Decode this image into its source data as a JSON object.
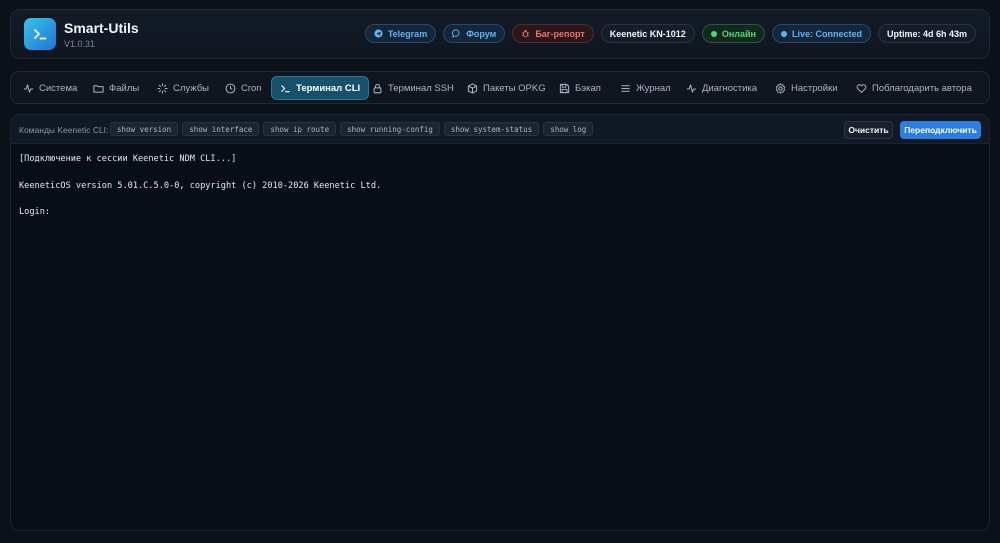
{
  "app": {
    "title": "Smart-Utils",
    "version": "V1.0.31"
  },
  "header_badges": {
    "telegram": "Telegram",
    "forum": "Форум",
    "bug_report": "Баг-репорт",
    "model": "Keenetic KN-1012",
    "online": "Онлайн",
    "live": "Live: Connected",
    "uptime": "Uptime: 4d 6h 43m"
  },
  "nav": {
    "tabs": [
      {
        "label": "Система",
        "icon": "activity-icon"
      },
      {
        "label": "Файлы",
        "icon": "folder-icon"
      },
      {
        "label": "Службы",
        "icon": "loader-icon"
      },
      {
        "label": "Cron",
        "icon": "clock-icon"
      },
      {
        "label": "Терминал CLI",
        "icon": "terminal-icon",
        "active": true
      },
      {
        "label": "Терминал SSH",
        "icon": "lock-icon"
      },
      {
        "label": "Пакеты OPKG",
        "icon": "package-icon"
      },
      {
        "label": "Бэкап",
        "icon": "save-icon"
      },
      {
        "label": "Журнал",
        "icon": "list-icon"
      },
      {
        "label": "Диагностика",
        "icon": "pulse-icon"
      },
      {
        "label": "Настройки",
        "icon": "gear-icon"
      },
      {
        "label": "Поблагодарить автора",
        "icon": "heart-icon"
      }
    ]
  },
  "terminal": {
    "commands_label": "Команды Keenetic CLI:",
    "quick_commands": [
      "show version",
      "show interface",
      "show ip route",
      "show running-config",
      "show system-status",
      "show log"
    ],
    "clear_label": "Очистить",
    "reconnect_label": "Переподключить",
    "output_lines": [
      "[Подключение к сессии Keenetic NDM CLI...]",
      "",
      "KeeneticOS version 5.01.C.5.0-0, copyright (c) 2010-2026 Keenetic Ltd.",
      "",
      "Login:"
    ]
  },
  "colors": {
    "background": "#0b1019",
    "accent": "#2a7fe0",
    "active_tab": "#16506a",
    "online": "#4fd67d",
    "bug": "#f0736d",
    "link": "#5cb6f0"
  }
}
